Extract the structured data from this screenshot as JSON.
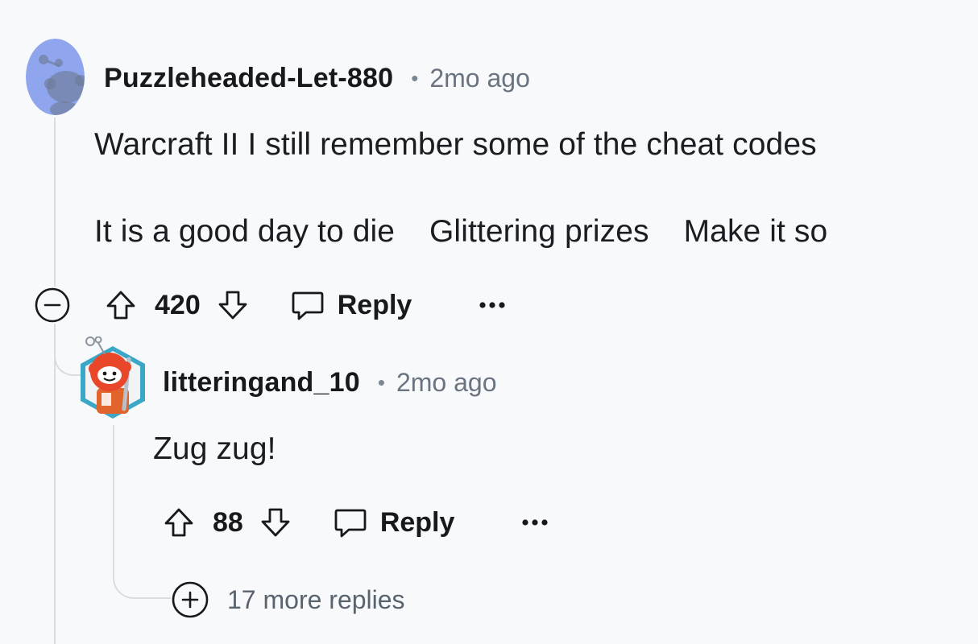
{
  "comment": {
    "username": "Puzzleheaded-Let-880",
    "separator": "•",
    "time": "2mo ago",
    "body_line_1": "Warcraft II I still remember some of the cheat codes",
    "body_line_2_segments": [
      "It is a good day to die",
      "Glittering prizes",
      "Make it so"
    ],
    "score": "420",
    "reply_label": "Reply",
    "more_label": "•••",
    "avatar_icon": "snoo-avatar-icon"
  },
  "reply": {
    "username": "litteringand_10",
    "separator": "•",
    "time": "2mo ago",
    "body": "Zug zug!",
    "score": "88",
    "reply_label": "Reply",
    "more_label": "•••",
    "avatar_icon": "robot-snoo-avatar-icon"
  },
  "more_replies": {
    "label": "17 more replies"
  },
  "colors": {
    "background": "#f8f9fb",
    "thread_line": "#d9dde2",
    "text_primary": "#161a1d",
    "text_secondary": "#6a7480",
    "avatar_bg": "#8fa6ee"
  }
}
